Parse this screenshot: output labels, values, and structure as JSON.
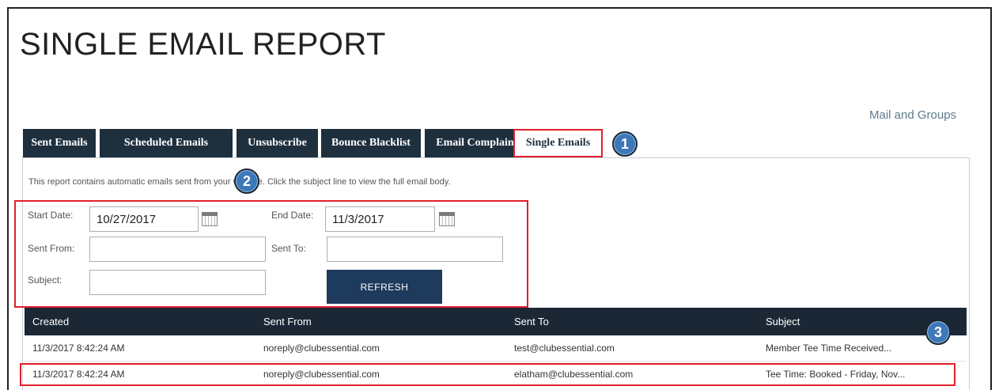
{
  "page_title": "SINGLE EMAIL REPORT",
  "nav_link": "Mail and Groups",
  "tabs": [
    {
      "label": "Sent Emails"
    },
    {
      "label": "Scheduled Emails"
    },
    {
      "label": "Unsubscribe"
    },
    {
      "label": "Bounce Blacklist"
    },
    {
      "label": "Email Complaints"
    },
    {
      "label": "Single Emails",
      "active": true
    }
  ],
  "callouts": [
    "1",
    "2",
    "3"
  ],
  "description": "This report contains automatic emails sent from your website. Click the subject line to view the full email body.",
  "filters": {
    "start_date_label": "Start Date:",
    "start_date_value": "10/27/2017",
    "end_date_label": "End Date:",
    "end_date_value": "11/3/2017",
    "sent_from_label": "Sent From:",
    "sent_from_value": "",
    "sent_to_label": "Sent To:",
    "sent_to_value": "",
    "subject_label": "Subject:",
    "subject_value": "",
    "refresh_label": "REFRESH"
  },
  "table": {
    "headers": [
      "Created",
      "Sent From",
      "Sent To",
      "Subject"
    ],
    "rows": [
      [
        "11/3/2017 8:42:24 AM",
        "noreply@clubessential.com",
        "test@clubessential.com",
        "Member Tee Time Received..."
      ],
      [
        "11/3/2017 8:42:24 AM",
        "noreply@clubessential.com",
        "elatham@clubessential.com",
        "Tee Time: Booked - Friday, Nov..."
      ]
    ]
  },
  "colors": {
    "tab_bg": "#1e2f3e",
    "highlight": "#e0202c",
    "callout": "#3d78b8",
    "button": "#1e3a5c",
    "table_header": "#1b2735"
  },
  "icons": [
    "calendar-icon"
  ]
}
